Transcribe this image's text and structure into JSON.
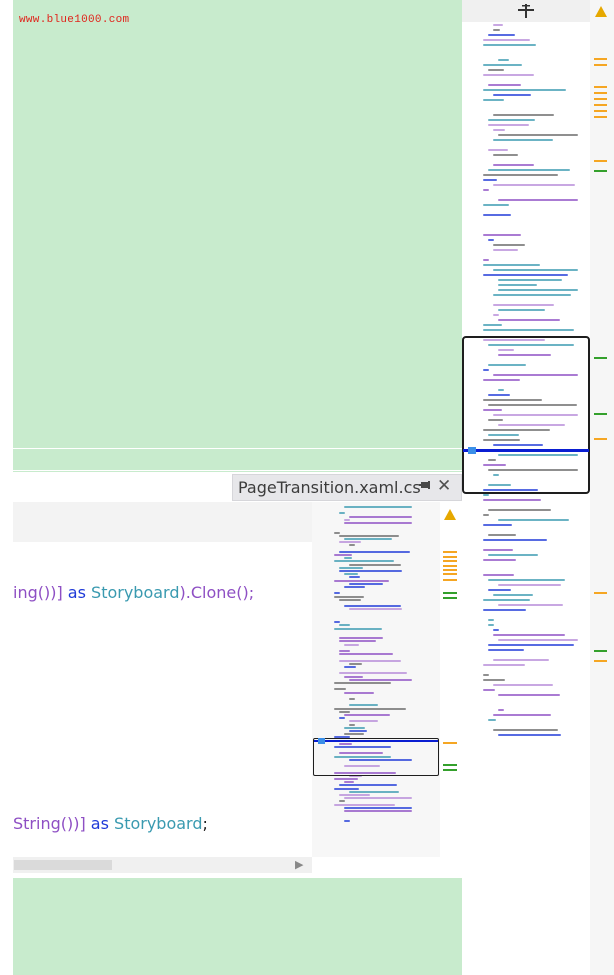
{
  "watermark": "www.blue1000.com",
  "tab": {
    "title": "PageTransition.xaml.cs"
  },
  "code_lines": [
    {
      "prefix": "ing())]",
      "kw": " as ",
      "type": "Storyboard",
      "suffix": ").Clone();"
    },
    {
      "prefix": "String())]",
      "kw": " as ",
      "type": "Storyboard",
      "suffix": ";"
    }
  ],
  "icons": {
    "warning": "warning-icon",
    "pin": "pin-icon",
    "close": "close-icon",
    "filter": "filter-icon",
    "scroll_right": "chevron-right-icon"
  },
  "colors": {
    "background_green": "#c8ebcd",
    "keyword_blue": "#1f3ad8",
    "type_teal": "#3a9ab0",
    "method_purple": "#8e4fc4",
    "text_dark": "#1e1e1e",
    "marker_orange": "#f5a623",
    "marker_green": "#34a02c",
    "cursor_blue": "#0a1ed2"
  }
}
